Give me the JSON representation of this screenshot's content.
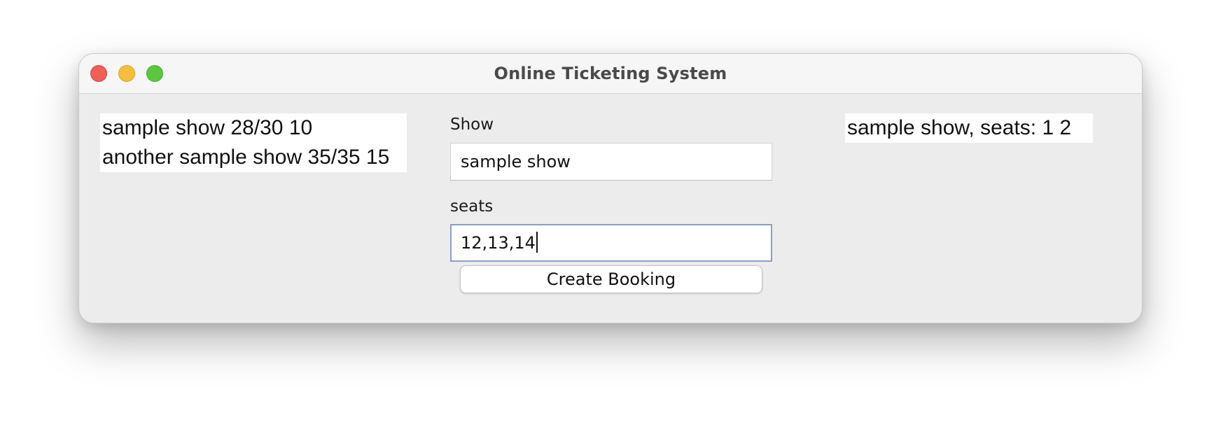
{
  "window": {
    "title": "Online Ticketing System",
    "controls": {
      "close": "close-icon",
      "minimize": "minimize-icon",
      "zoom": "zoom-icon"
    }
  },
  "shows": {
    "items": [
      "sample show 28/30 10",
      "another sample show 35/35 15"
    ]
  },
  "form": {
    "show_label": "Show",
    "show_value": "sample show",
    "seats_label": "seats",
    "seats_value": "12,13,14",
    "submit_label": "Create Booking"
  },
  "bookings": {
    "output": "sample show, seats: 1 2"
  },
  "colors": {
    "close": "#ee5f58",
    "minimize": "#f6bd3e",
    "zoom": "#5dc640",
    "focus_border": "#8aa0c2"
  }
}
